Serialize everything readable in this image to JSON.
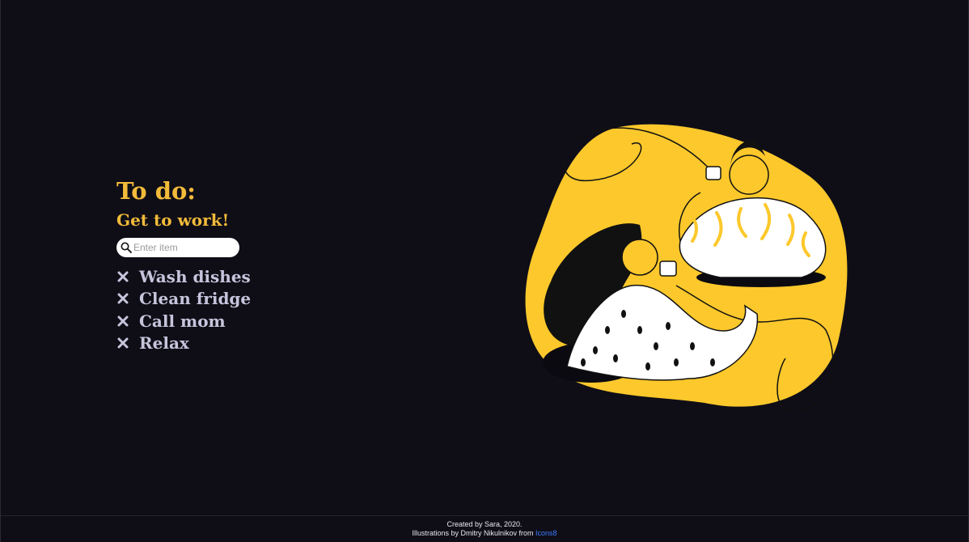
{
  "todo": {
    "title": "To do:",
    "subtitle": "Get to work!",
    "input": {
      "placeholder": "Enter item",
      "value": ""
    },
    "items": [
      {
        "label": "Wash dishes",
        "action_icon": "close-icon"
      },
      {
        "label": "Clean fridge",
        "action_icon": "close-icon"
      },
      {
        "label": "Call mom",
        "action_icon": "close-icon"
      },
      {
        "label": "Relax",
        "action_icon": "close-icon"
      }
    ]
  },
  "footer": {
    "line1": "Created by Sara, 2020.",
    "line2_prefix": "Illustrations by Dmitry Nikulnikov from ",
    "line2_link": "Icons8"
  },
  "colors": {
    "background": "#0f0e17",
    "accent": "#f3bb3a",
    "item_text": "#c6c5dc",
    "illustration_yellow": "#fcc82b",
    "link": "#3d7bff"
  }
}
